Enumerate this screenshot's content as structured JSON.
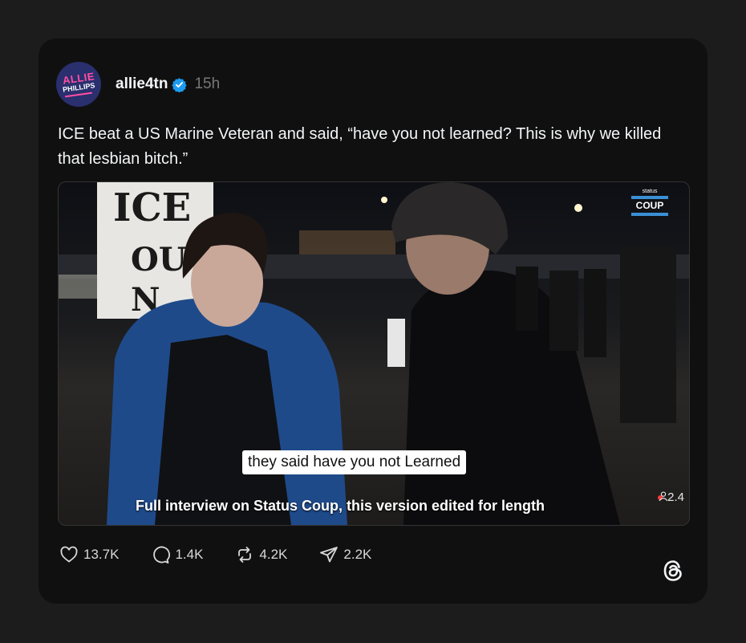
{
  "post": {
    "avatar": {
      "line1": "ALLIE",
      "line2": "PHILLIPS",
      "accent": "#ff4fa3",
      "bg": "#2a2f6e"
    },
    "username": "allie4tn",
    "verified_icon": "verified-badge-icon",
    "timestamp": "15h",
    "text": "ICE beat a US Marine Veteran and said, “have you not learned? This is why we killed that lesbian bitch.”"
  },
  "media": {
    "sign_text": "ICE\nOU\nN",
    "brand_small": "status",
    "brand_name": "COUP",
    "caption": "they said have you not Learned",
    "subtitle": "Full interview on Status Coup, this version edited for length",
    "viewer_count": "2.4"
  },
  "actions": {
    "likes": "13.7K",
    "comments": "1.4K",
    "reposts": "4.2K",
    "shares": "2.2K"
  },
  "colors": {
    "background": "#1c1c1c",
    "card": "#101010",
    "verified": "#1d9bf0",
    "muted": "#777777"
  }
}
